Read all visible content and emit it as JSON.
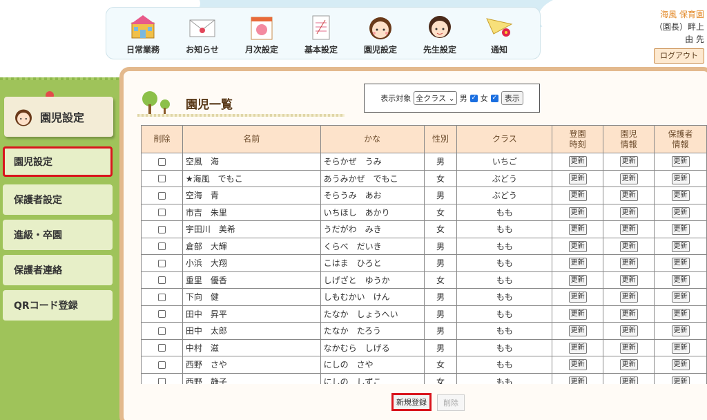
{
  "nav": [
    {
      "name": "nav-daily",
      "label": "日常業務",
      "icon": "school-building-icon"
    },
    {
      "name": "nav-notice",
      "label": "お知らせ",
      "icon": "envelope-icon"
    },
    {
      "name": "nav-monthly",
      "label": "月次設定",
      "icon": "calendar-icon"
    },
    {
      "name": "nav-basic",
      "label": "基本設定",
      "icon": "document-icon"
    },
    {
      "name": "nav-children",
      "label": "園児設定",
      "icon": "child-face-icon"
    },
    {
      "name": "nav-teacher",
      "label": "先生設定",
      "icon": "teacher-face-icon"
    },
    {
      "name": "nav-notify",
      "label": "通知",
      "icon": "paper-plane-icon"
    }
  ],
  "user": {
    "school": "海風 保育園",
    "role_line": "（園長）畔上　",
    "teacher_line": "由 先",
    "logout_label": "ログアウト"
  },
  "sidebar": {
    "title": "園児設定",
    "items": [
      {
        "label": "園児設定",
        "active": true
      },
      {
        "label": "保護者設定",
        "active": false
      },
      {
        "label": "進級・卒園",
        "active": false
      },
      {
        "label": "保護者連絡",
        "active": false
      },
      {
        "label": "QRコード登録",
        "active": false
      }
    ]
  },
  "main": {
    "title": "園児一覧",
    "filter": {
      "label": "表示対象",
      "selected": "全クラス",
      "male_label": "男",
      "female_label": "女",
      "show_label": "表示"
    },
    "columns": [
      "削除",
      "名前",
      "かな",
      "性別",
      "クラス",
      "登園\n時刻",
      "園児\n情報",
      "保護者\n情報"
    ],
    "update_label": "更新",
    "rows": [
      {
        "name": "空風　海",
        "kana": "そらかぜ　うみ",
        "gender": "男",
        "class": "いちご"
      },
      {
        "name": "★海風　でもこ",
        "kana": "あうみかぜ　でもこ",
        "gender": "女",
        "class": "ぶどう"
      },
      {
        "name": "空海　青",
        "kana": "そらうみ　あお",
        "gender": "男",
        "class": "ぶどう"
      },
      {
        "name": "市吉　朱里",
        "kana": "いちほし　あかり",
        "gender": "女",
        "class": "もも"
      },
      {
        "name": "宇田川　美希",
        "kana": "うだがわ　みき",
        "gender": "女",
        "class": "もも"
      },
      {
        "name": "倉部　大輝",
        "kana": "くらべ　だいき",
        "gender": "男",
        "class": "もも"
      },
      {
        "name": "小浜　大翔",
        "kana": "こはま　ひろと",
        "gender": "男",
        "class": "もも"
      },
      {
        "name": "重里　優香",
        "kana": "しげざと　ゆうか",
        "gender": "女",
        "class": "もも"
      },
      {
        "name": "下向　健",
        "kana": "しもむかい　けん",
        "gender": "男",
        "class": "もも"
      },
      {
        "name": "田中　昇平",
        "kana": "たなか　しょうへい",
        "gender": "男",
        "class": "もも"
      },
      {
        "name": "田中　太郎",
        "kana": "たなか　たろう",
        "gender": "男",
        "class": "もも"
      },
      {
        "name": "中村　滋",
        "kana": "なかむら　しげる",
        "gender": "男",
        "class": "もも"
      },
      {
        "name": "西野　さや",
        "kana": "にしの　さや",
        "gender": "女",
        "class": "もも"
      },
      {
        "name": "西野　静子",
        "kana": "にしの　しずこ",
        "gender": "女",
        "class": "もも"
      }
    ],
    "new_label": "新規登録",
    "delete_label": "削除"
  }
}
